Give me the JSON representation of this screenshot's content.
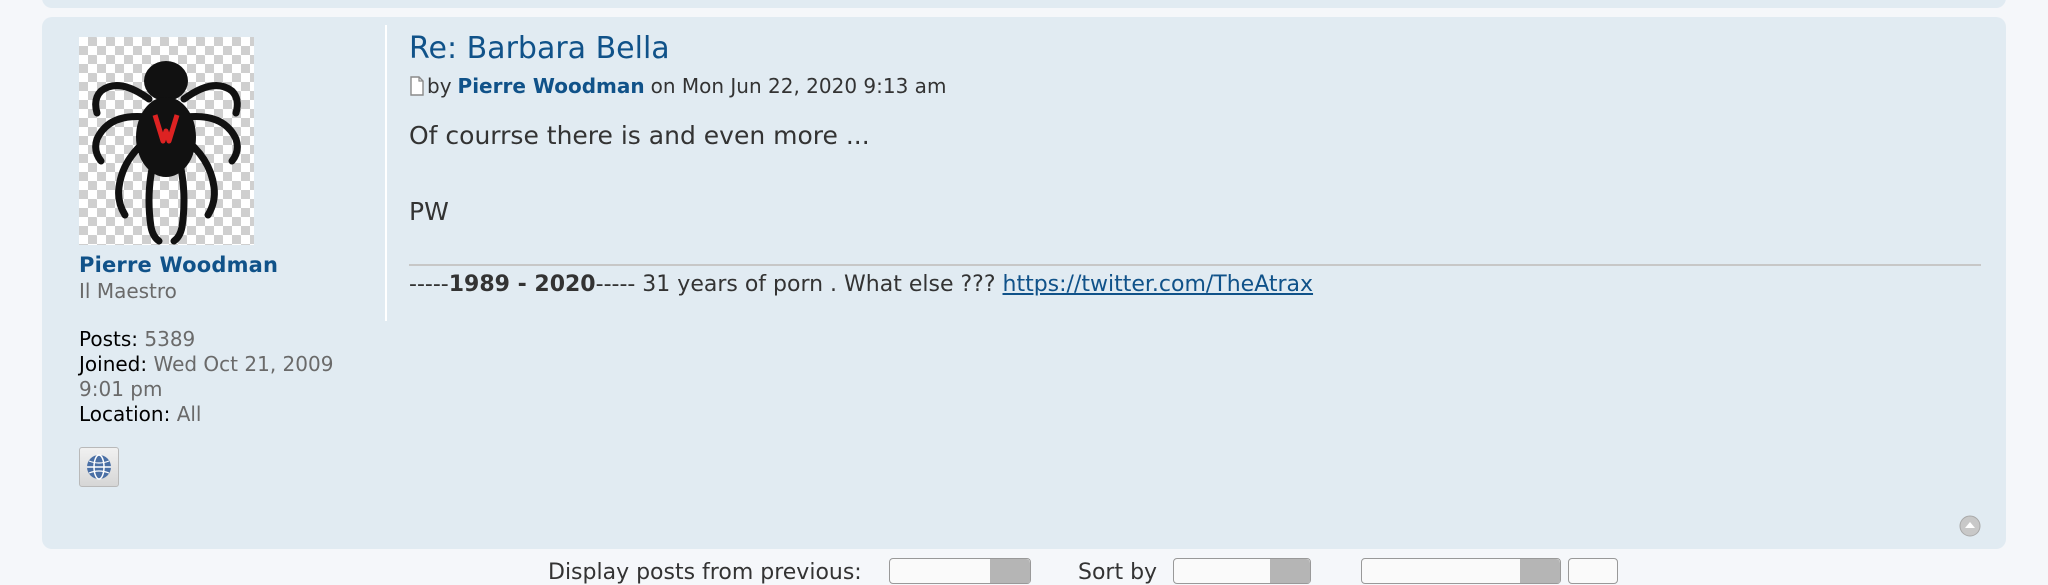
{
  "post": {
    "title": "Re: Barbara Bella",
    "by_label": "by",
    "author": "Pierre Woodman",
    "date_label": "on Mon Jun 22, 2020 9:13 am",
    "content_line1": "Of courrse there is and even more ...",
    "content_line2": "PW",
    "signature": {
      "prefix": "-----",
      "years": "1989 - 2020",
      "middle": "----- 31 years of porn . What else ??? ",
      "link": "https://twitter.com/TheAtrax"
    }
  },
  "profile": {
    "username": "Pierre Woodman",
    "rank": "Il Maestro",
    "posts_label": "Posts:",
    "posts_value": "5389",
    "joined_label": "Joined:",
    "joined_value": "Wed Oct 21, 2009 9:01 pm",
    "location_label": "Location:",
    "location_value": "All",
    "avatar_letter": "W"
  },
  "footer": {
    "display_label": "Display posts from previous:",
    "sort_label": "Sort by"
  },
  "colors": {
    "post_bg": "#e1ebf2",
    "link": "#105289",
    "text": "#333333"
  },
  "icons": [
    "post-icon",
    "website-globe-icon",
    "back-to-top-icon",
    "spider-avatar-icon"
  ]
}
